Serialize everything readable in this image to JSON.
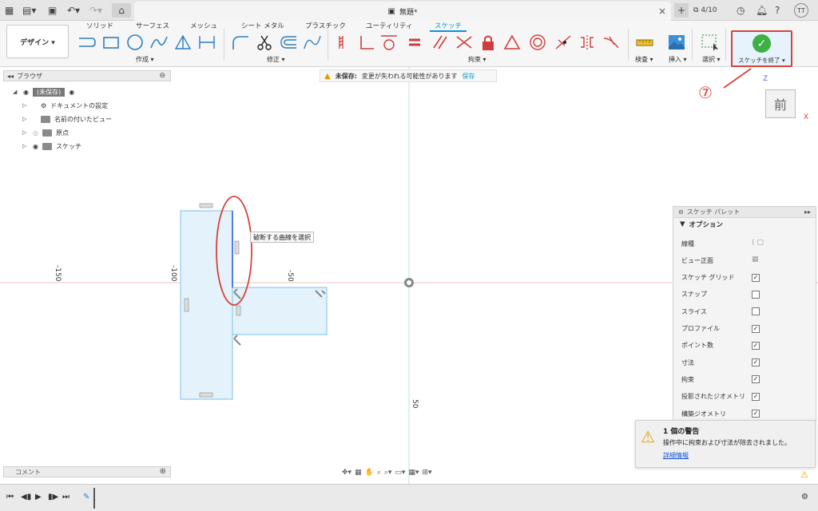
{
  "titlebar": {
    "doc_title": "無題*",
    "job_count": "4/10",
    "user_initials": "TT"
  },
  "ribbon": {
    "tabs": [
      "ソリッド",
      "サーフェス",
      "メッシュ",
      "シート メタル",
      "プラスチック",
      "ユーティリティ",
      "スケッチ"
    ],
    "active_tab": "スケッチ",
    "design_label": "デザイン ▾",
    "groups": {
      "create": "作成 ▾",
      "modify": "修正 ▾",
      "constraints": "拘束 ▾",
      "inspect": "検査 ▾",
      "insert": "挿入 ▾",
      "select": "選択 ▾"
    },
    "finish_label": "スケッチを終了 ▾"
  },
  "annotation": {
    "step_number": "⑦"
  },
  "browser": {
    "title": "ブラウザ",
    "root": "(未保存)",
    "items": [
      "ドキュメントの設定",
      "名前の付いたビュー",
      "原点",
      "スケッチ"
    ]
  },
  "warning_bar": {
    "label": "未保存:",
    "message": "変更が失われる可能性があります",
    "save": "保存"
  },
  "canvas": {
    "tooltip": "破断する曲線を選択",
    "axis_labels": [
      "-150",
      "-100",
      "-50",
      "50"
    ],
    "viewcube_face": "前",
    "axis_z": "Z",
    "axis_x": "X"
  },
  "palette": {
    "title": "スケッチ パレット",
    "section": "オプション",
    "rows": [
      {
        "label": "線種",
        "checked": null
      },
      {
        "label": "ビュー正面",
        "checked": null
      },
      {
        "label": "スケッチ グリッド",
        "checked": true
      },
      {
        "label": "スナップ",
        "checked": false
      },
      {
        "label": "スライス",
        "checked": false
      },
      {
        "label": "プロファイル",
        "checked": true
      },
      {
        "label": "ポイント数",
        "checked": true
      },
      {
        "label": "寸法",
        "checked": true
      },
      {
        "label": "拘束",
        "checked": true
      },
      {
        "label": "投影されたジオメトリ",
        "checked": true
      },
      {
        "label": "構築ジオメトリ",
        "checked": true
      }
    ],
    "check_mark": "✓"
  },
  "warning_panel": {
    "title": "1 個の警告",
    "message": "操作中に拘束および寸法が除去されました。",
    "link": "詳細情報"
  },
  "comment": {
    "label": "コメント"
  },
  "colors": {
    "accent": "#0696d7",
    "finish_border": "#d9423a",
    "check_green": "#3cb043",
    "sketch_fill": "#e3f2fb",
    "sketch_stroke": "#7cc0e8"
  }
}
